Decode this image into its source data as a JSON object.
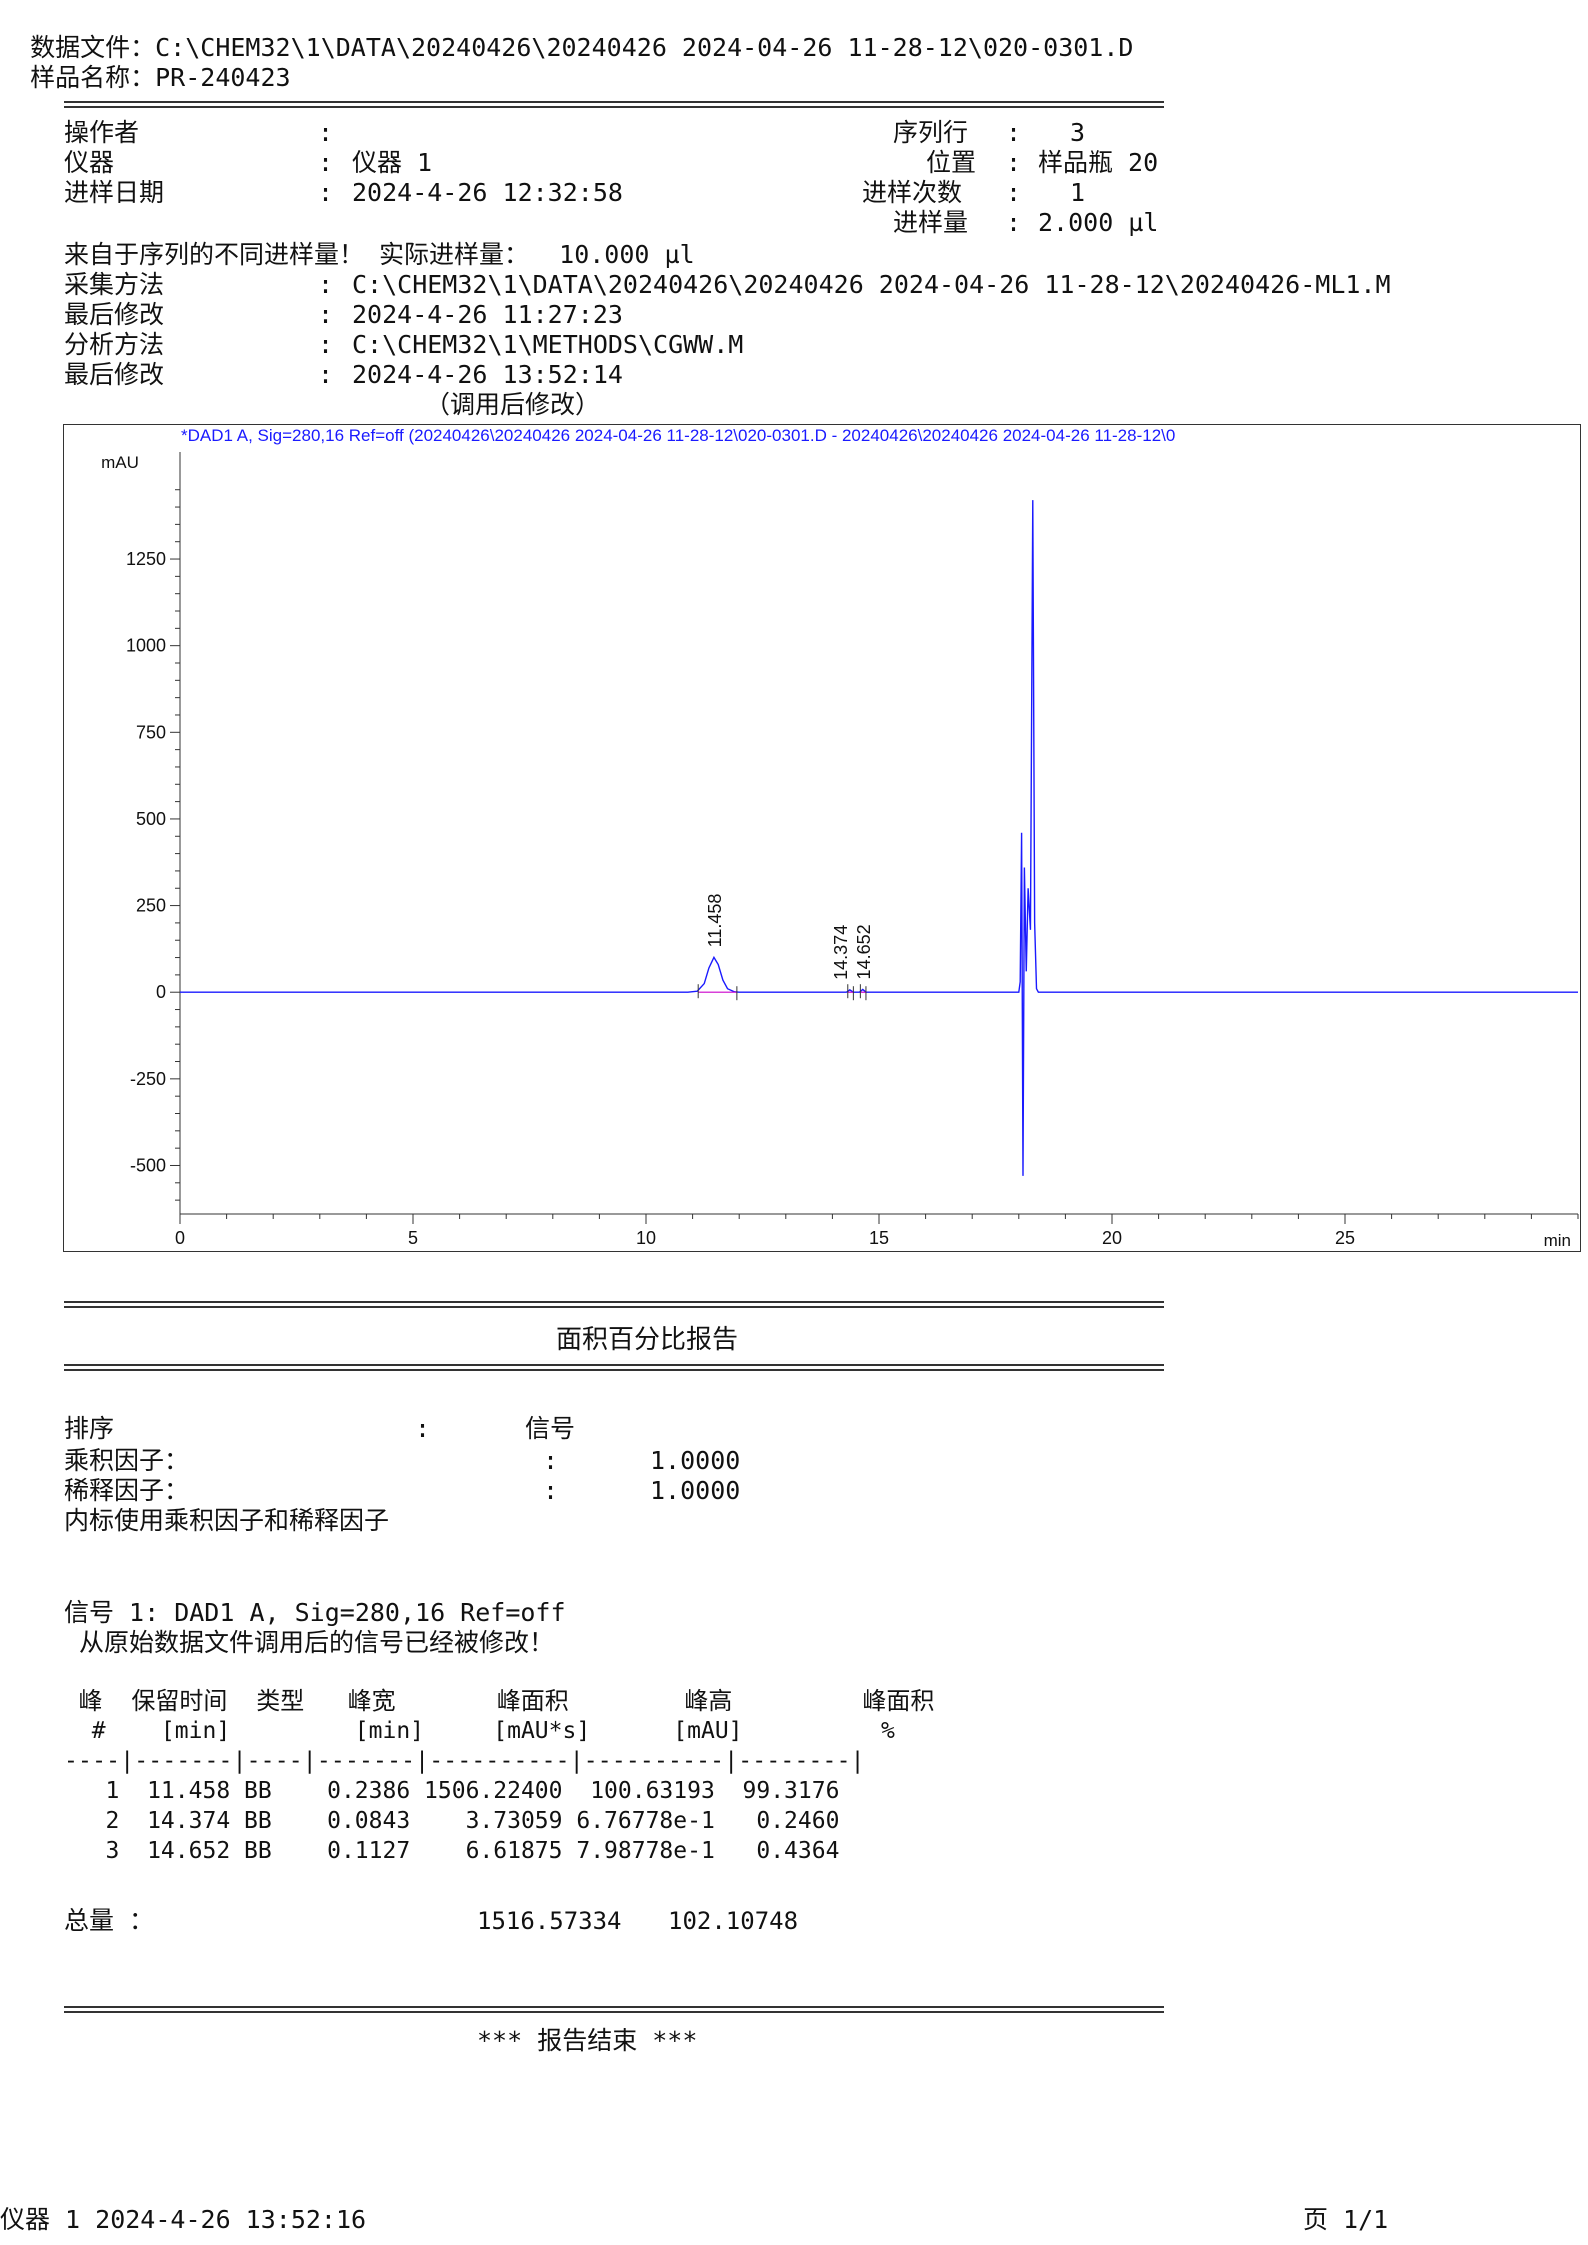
{
  "header": {
    "data_file_label": "数据文件：",
    "data_file_value": "C:\\CHEM32\\1\\DATA\\20240426\\20240426 2024-04-26 11-28-12\\020-0301.D",
    "sample_name_label": "样品名称：",
    "sample_name_value": "PR-240423"
  },
  "info": {
    "operator_label": "操作者",
    "operator_value": "",
    "instrument_label": "仪器",
    "instrument_value": "仪器 1",
    "inj_date_label": "进样日期",
    "inj_date_value": "2024-4-26 12:32:58",
    "seq_line_label": "序列行",
    "seq_line_value": "3",
    "location_label": "位置",
    "location_value": "样品瓶 20",
    "inj_count_label": "进样次数",
    "inj_count_value": "1",
    "inj_volume_label": "进样量",
    "inj_volume_value": "2.000 µl",
    "volume_note": "来自于序列的不同进样量！ 实际进样量：  10.000 µl",
    "acq_method_label": "采集方法",
    "acq_method_value": "C:\\CHEM32\\1\\DATA\\20240426\\20240426 2024-04-26 11-28-12\\20240426-ML1.M",
    "acq_modified_label": "最后修改",
    "acq_modified_value": "2024-4-26 11:27:23",
    "analysis_method_label": "分析方法",
    "analysis_method_value": "C:\\CHEM32\\1\\METHODS\\CGWW.M",
    "analysis_modified_label": "最后修改",
    "analysis_modified_value": "2024-4-26 13:52:14",
    "modified_note": "（调用后修改）"
  },
  "chart_data": {
    "type": "line",
    "title": "*DAD1 A, Sig=280,16 Ref=off (20240426\\20240426 2024-04-26 11-28-12\\020-0301.D - 20240426\\20240426 2024-04-26 11-28-12\\0",
    "ylabel": "mAU",
    "xlabel": "min",
    "xlim": [
      0,
      30
    ],
    "ylim": [
      -640,
      1530
    ],
    "x_ticks": [
      0,
      5,
      10,
      15,
      20,
      25
    ],
    "y_ticks": [
      -500,
      -250,
      0,
      250,
      500,
      750,
      1000,
      1250
    ],
    "colors": {
      "signal": "#1a1aff",
      "baseline_marks": "#cc00cc",
      "title": "#1a1aff"
    },
    "peak_labels": [
      "11.458",
      "14.374",
      "14.652"
    ],
    "series": [
      {
        "values": [
          [
            0,
            0
          ],
          [
            10.9,
            0
          ],
          [
            11.1,
            3
          ],
          [
            11.25,
            25
          ],
          [
            11.35,
            70
          ],
          [
            11.458,
            100.6
          ],
          [
            11.55,
            80
          ],
          [
            11.65,
            35
          ],
          [
            11.75,
            10
          ],
          [
            11.9,
            1
          ],
          [
            12.0,
            0
          ],
          [
            14.3,
            0
          ],
          [
            14.374,
            6.8
          ],
          [
            14.45,
            0
          ],
          [
            14.58,
            0
          ],
          [
            14.652,
            8.0
          ],
          [
            14.72,
            0
          ],
          [
            18.0,
            0
          ],
          [
            18.03,
            30
          ],
          [
            18.06,
            460
          ],
          [
            18.09,
            -530
          ],
          [
            18.12,
            360
          ],
          [
            18.16,
            60
          ],
          [
            18.2,
            300
          ],
          [
            18.25,
            180
          ],
          [
            18.3,
            1420
          ],
          [
            18.34,
            200
          ],
          [
            18.38,
            10
          ],
          [
            18.42,
            0
          ],
          [
            30,
            0
          ]
        ]
      }
    ]
  },
  "report": {
    "title": "面积百分比报告",
    "sort_label": "排序",
    "sort_sep": ":",
    "sort_value": "信号",
    "multiplier_label": "乘积因子：",
    "multiplier_value": "1.0000",
    "dilution_label": "稀释因子：",
    "dilution_value": "1.0000",
    "istd_note": "内标使用乘积因子和稀释因子",
    "signal_line": "信号 1: DAD1 A, Sig=280,16 Ref=off",
    "signal_note": " 从原始数据文件调用后的信号已经被修改！",
    "col_header_1": " 峰  保留时间  类型   峰宽       峰面积        峰高         峰面积",
    "col_header_2": "  #    [min]         [min]     [mAU*s]      [mAU]          %",
    "col_rule": "----|-------|----|-------|----------|----------|--------|",
    "rows": [
      "   1  11.458 BB    0.2386 1506.22400  100.63193  99.3176",
      "   2  14.374 BB    0.0843    3.73059 6.76778e-1   0.2460",
      "   3  14.652 BB    0.1127    6.61875 7.98778e-1   0.4364"
    ],
    "total_label": "总量 ：",
    "total_area": "1516.57334",
    "total_height": "102.10748",
    "end_text": "*** 报告结束 ***"
  },
  "footer": {
    "left": "仪器 1 2024-4-26 13:52:16",
    "right": "页 1/1"
  }
}
